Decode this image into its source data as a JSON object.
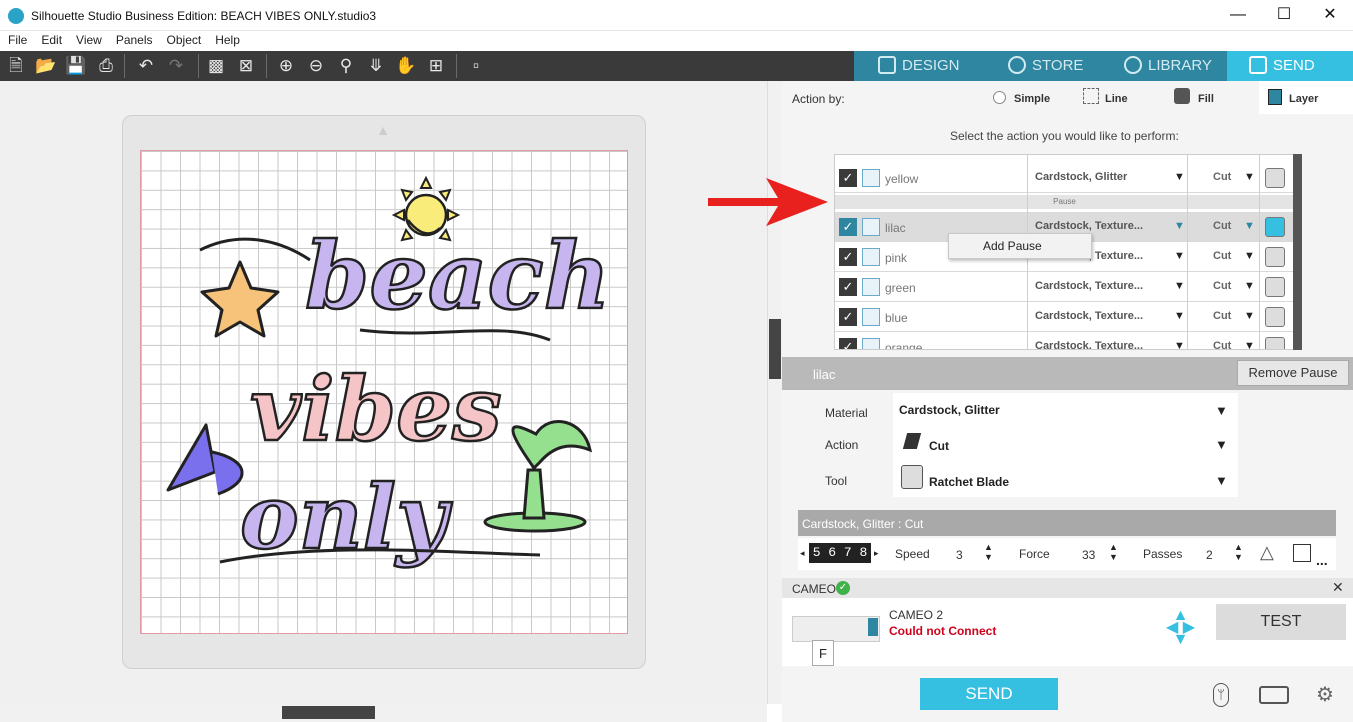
{
  "window": {
    "title": "Silhouette Studio Business Edition: BEACH VIBES ONLY.studio3",
    "minimize": "—",
    "maximize": "☐",
    "close": "✕"
  },
  "menu": [
    "File",
    "Edit",
    "View",
    "Panels",
    "Object",
    "Help"
  ],
  "nav_tabs": {
    "design": "DESIGN",
    "store": "STORE",
    "library": "LIBRARY",
    "send": "SEND"
  },
  "action_by": {
    "label": "Action by:",
    "options": [
      "Simple",
      "Line",
      "Fill",
      "Layer"
    ],
    "selected": "Layer"
  },
  "instruction": "Select the action you would like to perform:",
  "pause_label": "Pause",
  "layers": [
    {
      "name": "yellow",
      "material": "Cardstock, Glitter",
      "action": "Cut"
    },
    {
      "name": "lilac",
      "material": "Cardstock, Texture...",
      "action": "Cut"
    },
    {
      "name": "pink",
      "material": "Cardstock, Texture...",
      "action": "Cut"
    },
    {
      "name": "green",
      "material": "Cardstock, Texture...",
      "action": "Cut"
    },
    {
      "name": "blue",
      "material": "Cardstock, Texture...",
      "action": "Cut"
    },
    {
      "name": "orange",
      "material": "Cardstock, Texture...",
      "action": "Cut"
    }
  ],
  "context_menu": {
    "item": "Add Pause"
  },
  "selected_layer": {
    "name": "lilac",
    "remove_pause": "Remove Pause"
  },
  "settings": {
    "material_label": "Material",
    "material_value": "Cardstock, Glitter",
    "action_label": "Action",
    "action_value": "Cut",
    "tool_label": "Tool",
    "tool_value": "Ratchet Blade"
  },
  "cut_summary": "Cardstock, Glitter : Cut",
  "params": {
    "blade_digits": "5 6 7 8",
    "speed_label": "Speed",
    "speed_value": "3",
    "force_label": "Force",
    "force_value": "33",
    "passes_label": "Passes",
    "passes_value": "2",
    "more": "..."
  },
  "machine": {
    "header": "CAMEO",
    "name": "CAMEO 2",
    "status": "Could not Connect",
    "test_button": "TEST",
    "send_button": "SEND",
    "status_color": "#d0021b",
    "indicator_letter": "F"
  },
  "colors": {
    "accent": "#35bfe0",
    "nav_bg": "#2e86a0",
    "arrow": "#e8201e"
  }
}
